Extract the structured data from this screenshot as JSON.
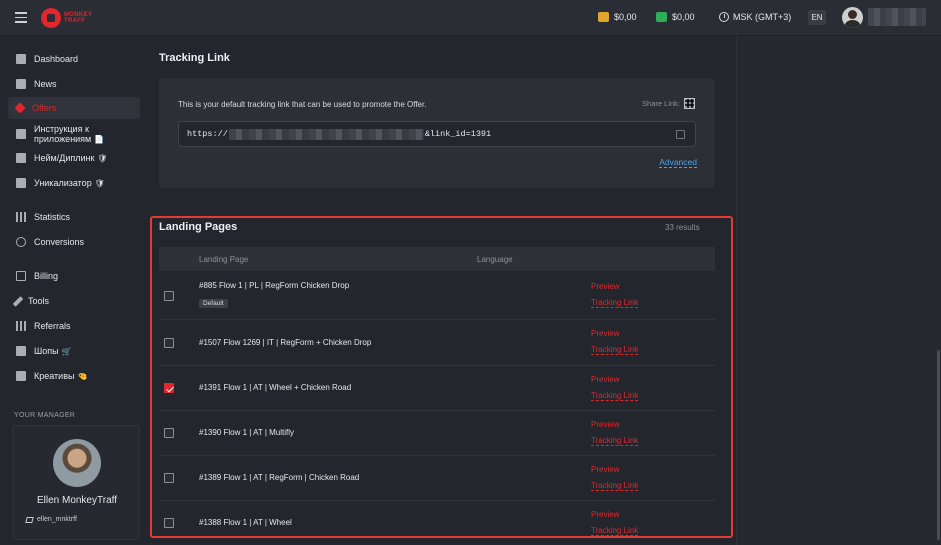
{
  "header": {
    "logo_text": "MONKEY TRAFF",
    "balance1": "$0,00",
    "balance2": "$0,00",
    "timezone": "MSK (GMT+3)",
    "language": "EN",
    "colors": {
      "balance1_icon": "#e0a52c",
      "balance2_icon": "#2fae5a",
      "accent": "#e0262e"
    }
  },
  "sidebar": {
    "items": [
      {
        "label": "Dashboard",
        "icon": "dashboard-icon"
      },
      {
        "label": "News",
        "icon": "news-icon"
      },
      {
        "label": "Offers",
        "icon": "tag-icon",
        "active": true
      },
      {
        "label": "Инструкция к приложениям",
        "icon": "doc-icon",
        "emoji": "📄"
      },
      {
        "label": "Нейм/Диплинк",
        "icon": "doc-icon",
        "emoji": "🛡"
      },
      {
        "label": "Уникализатор",
        "icon": "doc-icon",
        "emoji": "🛡"
      },
      {
        "label": "Statistics",
        "icon": "bars-icon"
      },
      {
        "label": "Conversions",
        "icon": "conversion-icon"
      },
      {
        "label": "Billing",
        "icon": "card-icon"
      },
      {
        "label": "Tools",
        "icon": "wrench-icon"
      },
      {
        "label": "Referrals",
        "icon": "referrals-icon"
      },
      {
        "label": "Шопы",
        "icon": "doc-icon",
        "emoji": "🛒"
      },
      {
        "label": "Креативы",
        "icon": "doc-icon",
        "emoji": "🤏"
      }
    ],
    "manager_title": "YOUR MANAGER",
    "manager_name": "Ellen MonkeyTraff",
    "manager_telegram": "ellen_mnktrff"
  },
  "tracking": {
    "title": "Tracking Link",
    "description": "This is your default tracking link that can be used to promote the Offer.",
    "share_label": "Share Link:",
    "link_prefix": "https://",
    "link_suffix": "&link_id=1391",
    "advanced_label": "Advanced"
  },
  "landing": {
    "title": "Landing Pages",
    "results": "33  results",
    "col_landing": "Landing Page",
    "col_language": "Language",
    "preview_label": "Preview",
    "tracking_label": "Tracking Link",
    "default_badge": "Default",
    "rows": [
      {
        "name": "#885 Flow 1 | PL | RegForm Chicken Drop",
        "checked": false,
        "default": true
      },
      {
        "name": "#1507 Flow 1269 | IT | RegForm + Chicken Drop",
        "checked": false
      },
      {
        "name": "#1391 Flow 1 | AT | Wheel + Chicken Road",
        "checked": true
      },
      {
        "name": "#1390 Flow 1 | AT | Multifly",
        "checked": false
      },
      {
        "name": "#1389 Flow 1 | AT | RegForm | Chicken Road",
        "checked": false
      },
      {
        "name": "#1388 Flow 1 | AT | Wheel",
        "checked": false
      }
    ]
  }
}
